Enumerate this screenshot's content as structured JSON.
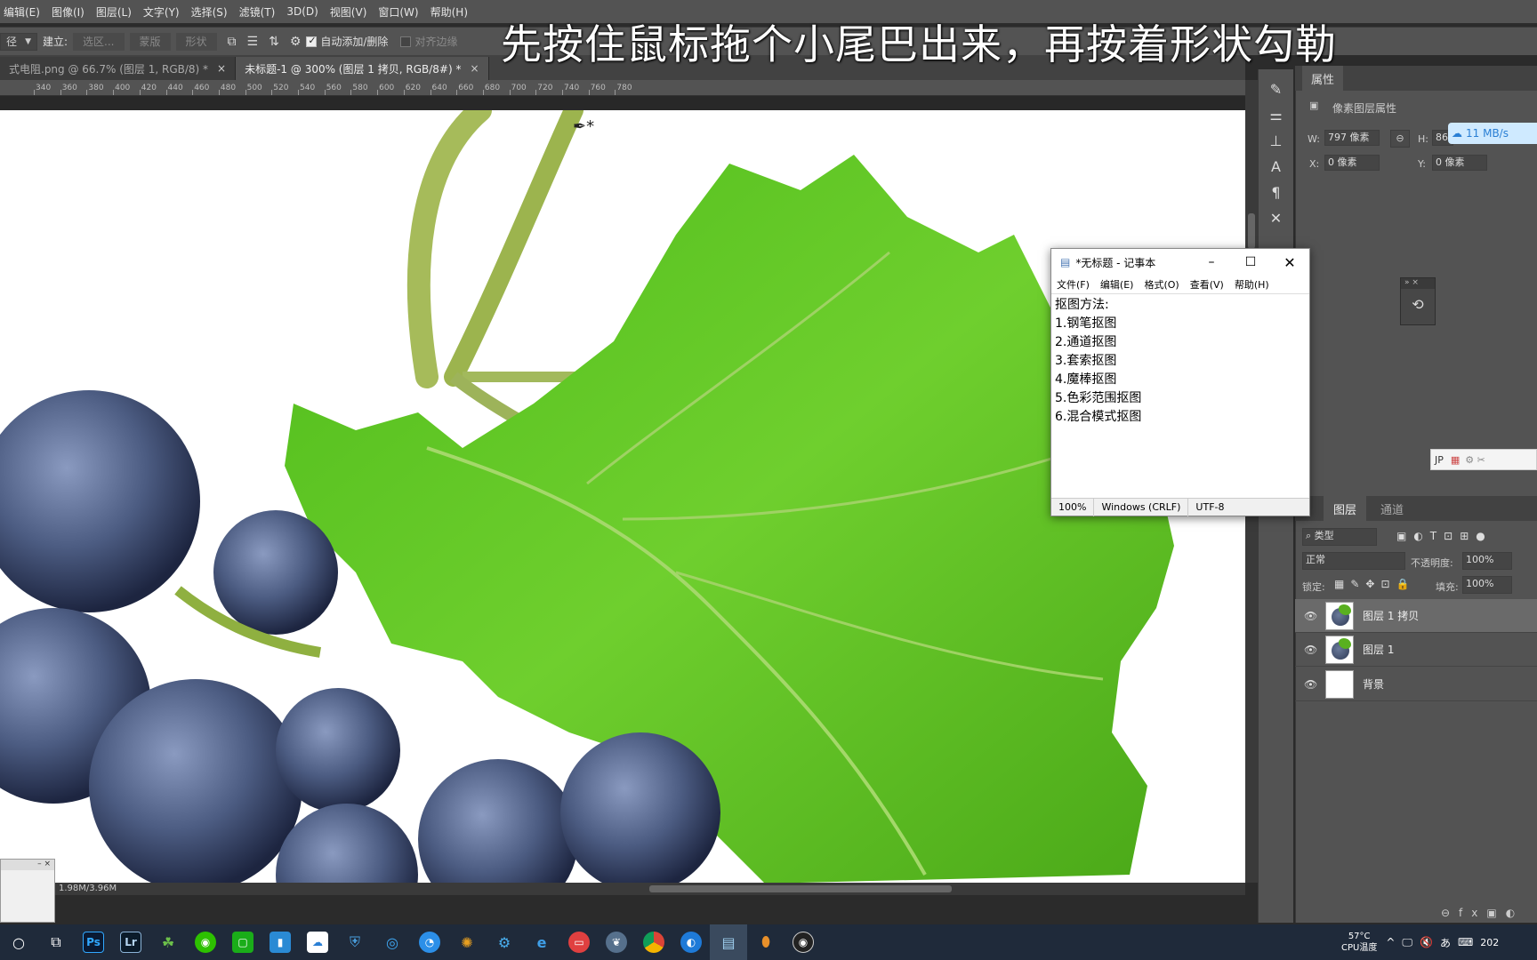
{
  "menubar": {
    "items": [
      "编辑(E)",
      "图像(I)",
      "图层(L)",
      "文字(Y)",
      "选择(S)",
      "滤镜(T)",
      "3D(D)",
      "视图(V)",
      "窗口(W)",
      "帮助(H)"
    ]
  },
  "caption": "先按住鼠标拖个小尾巴出来，再按着形状勾勒",
  "options": {
    "mode_select": "径",
    "build_label": "建立:",
    "selection_btn": "选区...",
    "mask_btn": "蒙版",
    "shape_btn": "形状",
    "auto_add_label": "自动添加/删除",
    "align_edges_label": "对齐边缘"
  },
  "tabs": [
    {
      "label": "式电阻.png @ 66.7% (图层 1, RGB/8) *",
      "close": "×"
    },
    {
      "label": "未标题-1 @ 300% (图层 1 拷贝, RGB/8#) *",
      "close": "×"
    }
  ],
  "ruler": {
    "ticks": [
      "340",
      "360",
      "380",
      "400",
      "420",
      "440",
      "460",
      "480",
      "500",
      "520",
      "540",
      "560",
      "580",
      "600",
      "620",
      "640",
      "660",
      "680",
      "700",
      "720",
      "740",
      "760",
      "780"
    ]
  },
  "statusbar": "1.98M/3.96M",
  "properties": {
    "tab": "属性",
    "section": "像素图层属性",
    "w_label": "W:",
    "w_value": "797 像素",
    "h_label": "H:",
    "h_value": "869",
    "x_label": "X:",
    "x_value": "0 像素",
    "y_label": "Y:",
    "y_value": "0 像素"
  },
  "netspeed": "11 MB/s",
  "layers_panel": {
    "tab_layers": "图层",
    "tab_channels": "通道",
    "filter": "类型",
    "blend_mode": "正常",
    "opacity_label": "不透明度:",
    "opacity_value": "100%",
    "lock_label": "锁定:",
    "fill_label": "填充:",
    "fill_value": "100%",
    "layers": [
      {
        "name": "图层 1 拷贝",
        "selected": true
      },
      {
        "name": "图层 1",
        "selected": false
      },
      {
        "name": "背景",
        "selected": false
      }
    ]
  },
  "notepad": {
    "title": "*无标题 - 记事本",
    "menu": [
      "文件(F)",
      "编辑(E)",
      "格式(O)",
      "查看(V)",
      "帮助(H)"
    ],
    "lines": [
      "抠图方法:",
      "1.钢笔抠图",
      "2.通道抠图",
      "3.套索抠图",
      "4.魔棒抠图",
      "5.色彩范围抠图",
      "6.混合模式抠图"
    ],
    "status_zoom": "100%",
    "status_eol": "Windows (CRLF)",
    "status_enc": "UTF-8"
  },
  "tray": {
    "temp": "57°C",
    "temp_label": "CPU温度",
    "ime": "あ",
    "year_partial": "202"
  },
  "taskbar": {
    "ps": "Ps",
    "lr": "Lr"
  }
}
